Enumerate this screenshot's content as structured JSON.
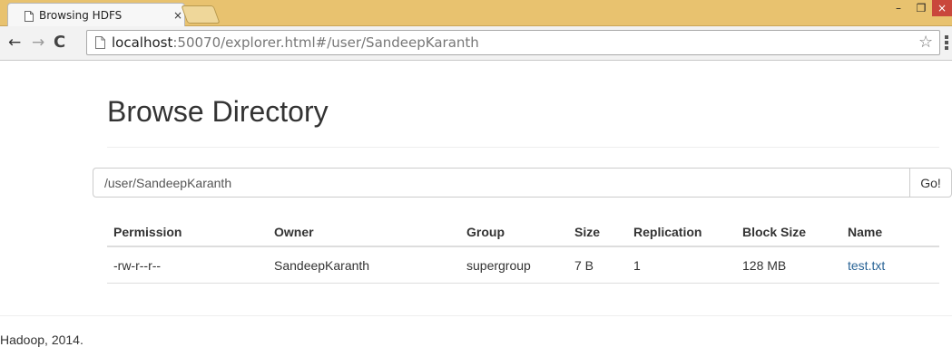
{
  "browser": {
    "tab_title": "Browsing HDFS",
    "tab_close": "×",
    "window_controls": {
      "minimize": "–",
      "maximize": "❐",
      "close": "×"
    },
    "nav": {
      "back": "←",
      "forward": "→",
      "reload": "C"
    },
    "url_host": "localhost",
    "url_path": ":50070/explorer.html#/user/SandeepKaranth",
    "bookmark_star": "☆",
    "colors": {
      "frame": "#e8c26f",
      "close_button": "#c9473c"
    }
  },
  "page": {
    "title": "Browse Directory",
    "directory_input": {
      "value": "/user/SandeepKaranth"
    },
    "go_button": "Go!",
    "table": {
      "headers": [
        "Permission",
        "Owner",
        "Group",
        "Size",
        "Replication",
        "Block Size",
        "Name"
      ],
      "rows": [
        [
          "-rw-r--r--",
          "SandeepKaranth",
          "supergroup",
          "7 B",
          "1",
          "128 MB",
          "test.txt"
        ]
      ]
    },
    "footer": "Hadoop, 2014.",
    "link_color": "#2a6496"
  }
}
